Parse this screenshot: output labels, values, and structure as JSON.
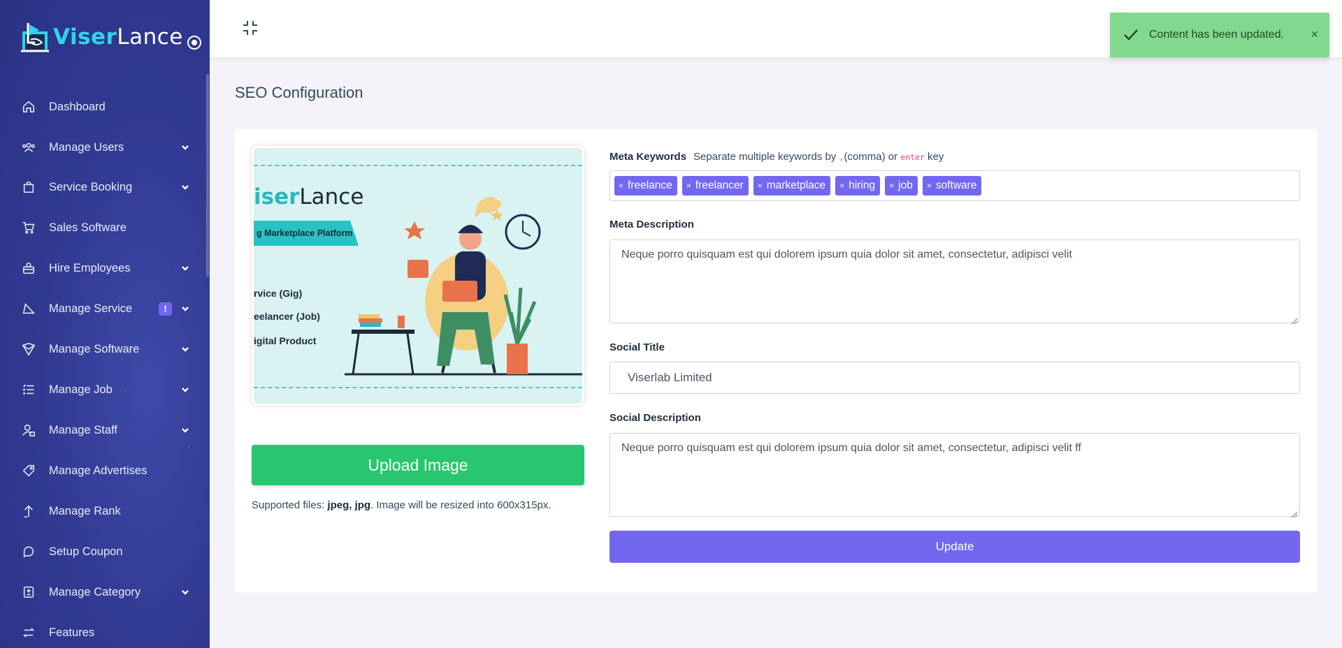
{
  "brand": {
    "name_accent": "Viser",
    "name_rest": "Lance"
  },
  "sidebar": {
    "items": [
      {
        "label": "Dashboard",
        "icon": "home-icon",
        "has_submenu": false
      },
      {
        "label": "Manage Users",
        "icon": "users-icon",
        "has_submenu": true
      },
      {
        "label": "Service Booking",
        "icon": "shopping-bag-icon",
        "has_submenu": true
      },
      {
        "label": "Sales Software",
        "icon": "cart-icon",
        "has_submenu": false
      },
      {
        "label": "Hire Employees",
        "icon": "hire-icon",
        "has_submenu": true
      },
      {
        "label": "Manage Service",
        "icon": "service-icon",
        "has_submenu": true,
        "badge": "!"
      },
      {
        "label": "Manage Software",
        "icon": "software-icon",
        "has_submenu": true
      },
      {
        "label": "Manage Job",
        "icon": "list-icon",
        "has_submenu": true
      },
      {
        "label": "Manage Staff",
        "icon": "staff-icon",
        "has_submenu": true
      },
      {
        "label": "Manage Advertises",
        "icon": "tag-icon",
        "has_submenu": false
      },
      {
        "label": "Manage Rank",
        "icon": "arrow-up-icon",
        "has_submenu": false
      },
      {
        "label": "Setup Coupon",
        "icon": "coupon-icon",
        "has_submenu": false
      },
      {
        "label": "Manage Category",
        "icon": "category-icon",
        "has_submenu": true
      },
      {
        "label": "Features",
        "icon": "exchange-icon",
        "has_submenu": false
      }
    ]
  },
  "toast": {
    "message": "Content has been updated.",
    "close": "×"
  },
  "page": {
    "title": "SEO Configuration"
  },
  "preview": {
    "brand_accent": "iser",
    "brand_rest": "Lance",
    "ribbon": "g Marketplace Platform",
    "lines": [
      "rvice (Gig)",
      "eelancer (Job)",
      "igital Product"
    ]
  },
  "upload": {
    "button_label": "Upload Image",
    "support_prefix": "Supported files: ",
    "support_types": "jpeg, jpg",
    "support_suffix": ". Image will be resized into 600x315px."
  },
  "form": {
    "meta_keywords": {
      "label": "Meta Keywords",
      "hint_before": "Separate multiple keywords by ",
      "hint_comma_code": ",",
      "hint_mid": "(comma) or ",
      "hint_enter_code": "enter",
      "hint_after": " key",
      "tags": [
        "freelance",
        "freelancer",
        "marketplace",
        "hiring",
        "job",
        "software"
      ],
      "tag_remove": "×"
    },
    "meta_description": {
      "label": "Meta Description",
      "value": "Neque porro quisquam est qui dolorem ipsum quia dolor sit amet, consectetur, adipisci velit"
    },
    "social_title": {
      "label": "Social Title",
      "value": "Viserlab Limited"
    },
    "social_description": {
      "label": "Social Description",
      "value": "Neque porro quisquam est qui dolorem ipsum quia dolor sit amet, consectetur, adipisci velit ff"
    },
    "update_label": "Update"
  },
  "colors": {
    "primary": "#7367f0",
    "success": "#28c76f",
    "sidebar": "#323b93",
    "toast": "#82d88d"
  }
}
